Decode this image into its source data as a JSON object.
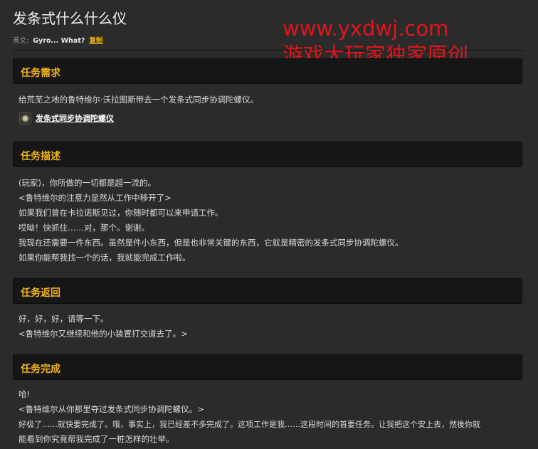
{
  "page": {
    "title": "发条式什么什么仪",
    "english_label": "英文:",
    "english_name": "Gyro... What?",
    "copy_label": "复制"
  },
  "watermark": {
    "line1": "www.yxdwj.com",
    "line2": "游戏大玩家独家原创"
  },
  "requirements": {
    "header": "任务需求",
    "text": "给荒芜之地的鲁特维尔·沃拉图斯带去一个发条式同步协调陀螺仪。",
    "item": {
      "label": "发条式同步协调陀螺仪",
      "icon": "gyroscope-item-icon"
    }
  },
  "description": {
    "header": "任务描述",
    "lines": [
      "(玩家)，你所做的一切都是超一流的。",
      "<鲁特维尔的注意力显然从工作中移开了>",
      "如果我们曾在卡拉诺斯见过，你随时都可以来申请工作。",
      "哎呦！快抓住……对，那个。谢谢。",
      "我现在还需要一件东西。虽然是件小东西，但是也非常关键的东西，它就是精密的发条式同步协调陀螺仪。",
      "如果你能帮我找一个的话，我就能完成工作啦。"
    ]
  },
  "progress": {
    "header": "任务返回",
    "lines": [
      "好，好，好，请等一下。",
      "<鲁特维尔又继续和他的小装置打交道去了。>"
    ]
  },
  "completion": {
    "header": "任务完成",
    "lines": [
      "哈!",
      "<鲁特维尔从你那里夺过发条式同步协调陀螺仪。>",
      "好极了……就快要完成了。哦，事实上，我已经差不多完成了。这项工作是我……这段时间的首要任务。让我把这个安上去，然後你就",
      "能看到你究竟帮我完成了一桩怎样的壮举。"
    ]
  },
  "colors": {
    "background": "#2b2b2b",
    "header_bg": "#161616",
    "header_text": "#f0b21b",
    "link_yellow": "#f2b705",
    "watermark_red": "#e0151b"
  }
}
